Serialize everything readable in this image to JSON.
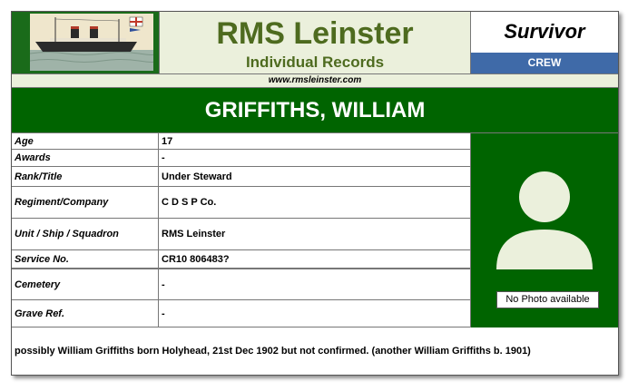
{
  "header": {
    "title": "RMS Leinster",
    "subtitle": "Individual Records",
    "status": "Survivor",
    "category": "CREW",
    "url": "www.rmsleinster.com",
    "ship_image_caption": "R.M.S. LEINSTER",
    "ship_image_icon": "steamship-illustration-icon"
  },
  "person": {
    "name": "GRIFFITHS,  WILLIAM"
  },
  "records": [
    {
      "label": "Age",
      "value": "17"
    },
    {
      "label": "Awards",
      "value": "-"
    },
    {
      "label": "Rank/Title",
      "value": "Under Steward"
    },
    {
      "label": "Regiment/Company",
      "value": "C D S P Co."
    },
    {
      "label": "Unit / Ship / Squadron",
      "value": "RMS Leinster"
    },
    {
      "label": "Service No.",
      "value": "CR10 806483?"
    },
    {
      "label": "Cemetery",
      "value": "-"
    },
    {
      "label": "Grave Ref.",
      "value": "-"
    }
  ],
  "photo": {
    "placeholder_icon": "person-silhouette-icon",
    "caption": "No Photo available"
  },
  "notes": "possibly William Griffiths born Holyhead, 21st Dec 1902 but not confirmed. (another William Griffiths b. 1901)",
  "colors": {
    "dark_green": "#006400",
    "light_green_bg": "#ebf0dc",
    "title_green": "#4e6b1f",
    "crew_blue": "#3f6aa8"
  }
}
